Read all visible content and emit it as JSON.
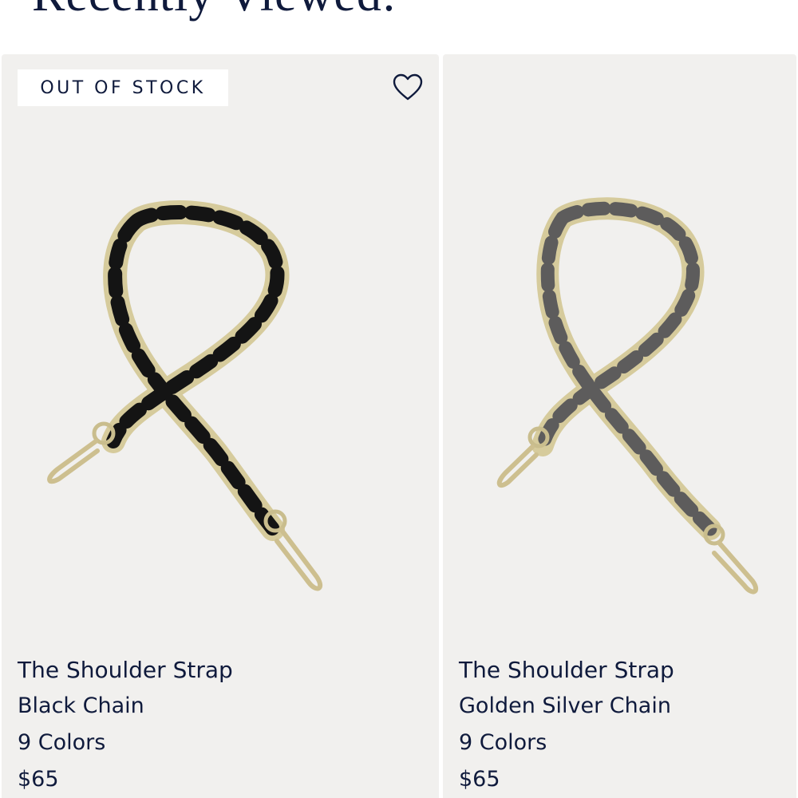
{
  "section": {
    "title": "Recently Viewed:"
  },
  "products": [
    {
      "badge": "OUT OF STOCK",
      "title": "The Shoulder Strap",
      "variant": "Black Chain",
      "colors": "9 Colors",
      "price": "$65",
      "wrap_color": "#141414",
      "image": "black-braided-chain-strap"
    },
    {
      "title": "The Shoulder Strap",
      "variant": "Golden Silver Chain",
      "colors": "9 Colors",
      "price": "$65",
      "wrap_color": "#5d5c5c",
      "image": "golden-silver-braided-chain-strap"
    }
  ],
  "icons": {
    "wishlist": "heart-outline-icon"
  },
  "colors": {
    "text": "#0f1a3c",
    "card_bg": "#f1f0ee",
    "chain_gold": "#d6cb9c"
  }
}
